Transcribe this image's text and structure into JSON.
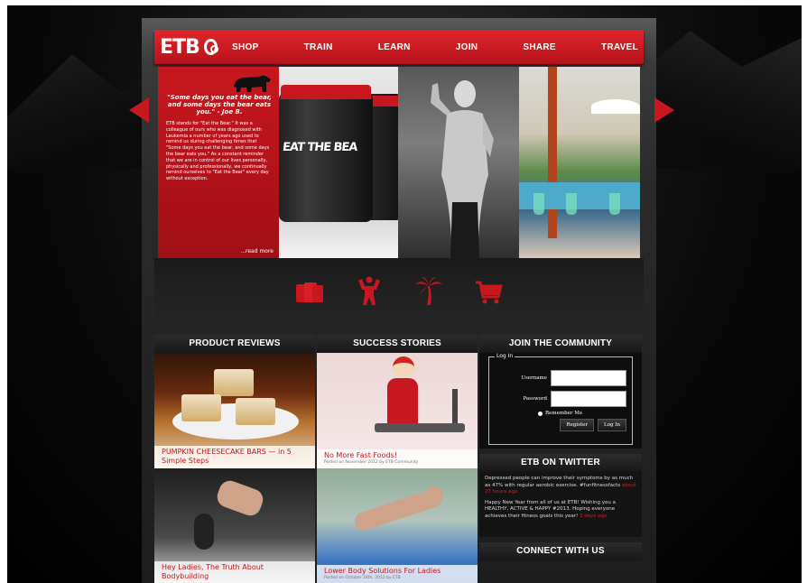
{
  "nav": {
    "logo": "ETB",
    "items": [
      "SHOP",
      "TRAIN",
      "LEARN",
      "JOIN",
      "SHARE",
      "TRAVEL"
    ]
  },
  "slider": {
    "quote": "\"Some days you eat the bear, and some days the bear eats you.\" - Joe B.",
    "text": "ETB stands for \"Eat the Bear.\" It was a colleague of ours who was diagnosed with Leukemia a number of years ago used to remind us during challenging times that \"Some days you eat the bear, and some days the bear eats you.\" As a constant reminder that we are in control of our lives personally, physically and professionally, we continually remind ourselves to \"Eat the Bear\" every day without exception.",
    "read_more": "...read more",
    "product_label": "EAT THE BEA"
  },
  "icons": [
    "supplements-icon",
    "bodybuilder-icon",
    "palm-tree-icon",
    "cart-icon"
  ],
  "columns": {
    "reviews": {
      "title": "PRODUCT REVIEWS",
      "cards": [
        {
          "title": "PUMPKIN CHEESECAKE BARS — in 5 Simple Steps",
          "meta": ""
        },
        {
          "title": "Hey Ladies, The Truth About Bodybuilding",
          "meta": ""
        }
      ]
    },
    "stories": {
      "title": "SUCCESS STORIES",
      "cards": [
        {
          "title": "No More Fast Foods!",
          "meta": "Posted on November 2012 by ETB Community"
        },
        {
          "title": "Lower Body Solutions For Ladies",
          "meta": "Posted on October 24th, 2012 by ETB"
        }
      ]
    },
    "community": {
      "title": "JOIN THE COMMUNITY",
      "login": {
        "legend": "Log In",
        "username_label": "Username",
        "password_label": "Password",
        "remember": "Remember Me",
        "register": "Register",
        "login": "Log In"
      },
      "twitter_title": "ETB ON TWITTER",
      "tweets": [
        {
          "text": "Depressed people can improve their symptoms by as much as 47% with regular aerobic exercise. #funfitnessfacts",
          "time": "about 27 hours ago"
        },
        {
          "text": "Happy New Year from all of us at ETB! Wishing you a HEALTHY, ACTIVE & HAPPY #2013. Hoping everyone achieves their fitness goals this year!",
          "time": "3 days ago"
        }
      ],
      "connect_title": "CONNECT WITH US"
    }
  }
}
